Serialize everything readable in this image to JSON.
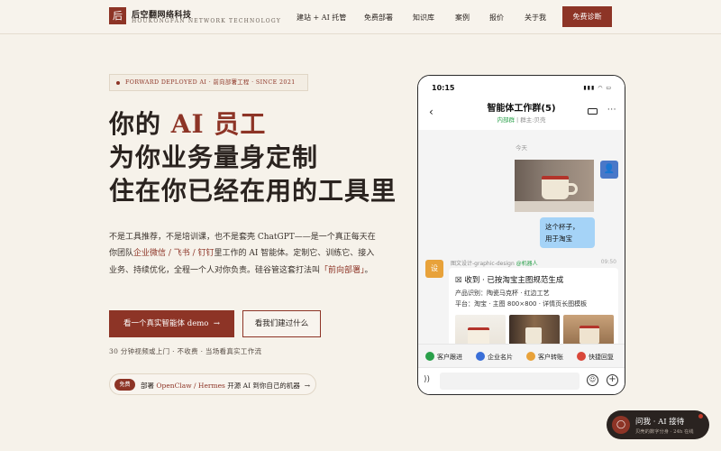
{
  "header": {
    "logo_char": "后",
    "brand_cn": "后空翻网络科技",
    "brand_en": "HOUKONGFAN NETWORK TECHNOLOGY",
    "nav": [
      "建站 + AI 托管",
      "免费部署",
      "知识库",
      "案例",
      "报价",
      "关于我"
    ],
    "cta": "免费诊断"
  },
  "hero": {
    "badge": "FORWARD DEPLOYED AI · 前向部署工程 · SINCE 2021",
    "title_pre": "你的 ",
    "title_accent": "AI 员工",
    "title_line2": "为你业务量身定制",
    "title_line3": "住在你已经在用的工具里",
    "desc_1": "不是工具推荐，不是培训课，也不是套壳 ChatGPT——是一个真正每天在你团队",
    "desc_hl1": "企业微信 / 飞书 / 钉钉",
    "desc_2": "里工作的 AI 智能体。定制它、训练它、接入业务、持续优化，全程一个人对你负责。硅谷管这套打法叫",
    "desc_hl2": "「前向部署」",
    "desc_3": "。",
    "btn_primary": "看一个真实智能体 demo",
    "btn_primary_arrow": "→",
    "btn_secondary": "看我们建过什么",
    "note": "30 分钟视频或上门 · 不收费 · 当场看真实工作流",
    "pill_tag": "免费",
    "pill_pre": "部署 ",
    "pill_hl": "OpenClaw / Hermes",
    "pill_post": " 开源 AI 到你自己的机器",
    "pill_arrow": "→"
  },
  "phone": {
    "time": "10:15",
    "status": "▮▮▮ ◠ ▭",
    "back": "‹",
    "title": "智能体工作群(5)",
    "sub_green": "内部群",
    "sub_rest": " | 群主:贝壳",
    "more": "···",
    "day": "今天",
    "me_avatar": "👤",
    "me_message_1": "这个杯子，",
    "me_message_2": "用于淘宝",
    "bot_avatar": "设",
    "bot_name": "图文设计-graphic-design",
    "bot_tag": " @机器人",
    "bot_time": "09:50",
    "card_title": "☒ 收到 · 已按淘宝主图规范生成",
    "card_line1": "产品识别：陶瓷马克杯 · 红边工艺",
    "card_line2": "平台：淘宝 · 主图 800×800 · 详情页长图模板",
    "quick_actions": [
      {
        "label": "客户跟进",
        "color": "#2aa04a"
      },
      {
        "label": "企业名片",
        "color": "#3a6fd8"
      },
      {
        "label": "客户转账",
        "color": "#e8a23a"
      },
      {
        "label": "快捷回复",
        "color": "#d9473a"
      }
    ],
    "voice": "))",
    "emoji": "☺",
    "plus": "+"
  },
  "widget": {
    "icon": "◯",
    "title": "问我 · AI 接待",
    "sub": "贝壳的数字分身 · 24h 在线"
  },
  "colors": {
    "accent": "#8d3426",
    "background": "#f6f2ea",
    "chat_bubble": "#a5d3f7"
  }
}
